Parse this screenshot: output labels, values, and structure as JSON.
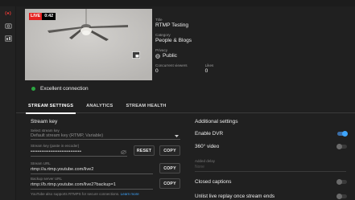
{
  "preview": {
    "live_label": "LIVE",
    "elapsed": "0:42"
  },
  "connection": {
    "status": "Excellent connection"
  },
  "meta": {
    "title_label": "Title",
    "title": "RTMP Testing",
    "category_label": "Category",
    "category": "People & Blogs",
    "privacy_label": "Privacy",
    "privacy": "Public",
    "viewers_label": "Concurrent viewers",
    "viewers": "0",
    "likes_label": "Likes",
    "likes": "0"
  },
  "tabs": [
    {
      "label": "STREAM SETTINGS"
    },
    {
      "label": "ANALYTICS"
    },
    {
      "label": "STREAM HEALTH"
    }
  ],
  "stream_key": {
    "header": "Stream key",
    "select_label": "Select stream key",
    "select_value": "Default stream key (RTMP, Variable)",
    "key_label": "Stream key (paste in encoder)",
    "key_value": "••••••••••••••••••••••••••••",
    "reset_label": "RESET",
    "copy_label": "COPY",
    "url_label": "Stream URL",
    "url_value": "rtmp://a.rtmp.youtube.com/live2",
    "backup_label": "Backup server URL",
    "backup_value": "rtmp://b.rtmp.youtube.com/live2?backup=1",
    "rtmps_note": "YouTube also supports RTMPS for secure connections.",
    "learn_more": "Learn more"
  },
  "additional": {
    "header": "Additional settings",
    "dvr_label": "Enable DVR",
    "dvr_on": true,
    "v360_label": "360° video",
    "v360_on": false,
    "added_delay_label": "Added delay",
    "added_delay_value": "None",
    "captions_label": "Closed captions",
    "captions_on": false,
    "unlist_label": "Unlist live replay once stream ends",
    "unlist_on": false
  },
  "colors": {
    "live_red": "#e52222",
    "connection_green": "#2ba640",
    "toggle_blue": "#3ea6ff"
  }
}
